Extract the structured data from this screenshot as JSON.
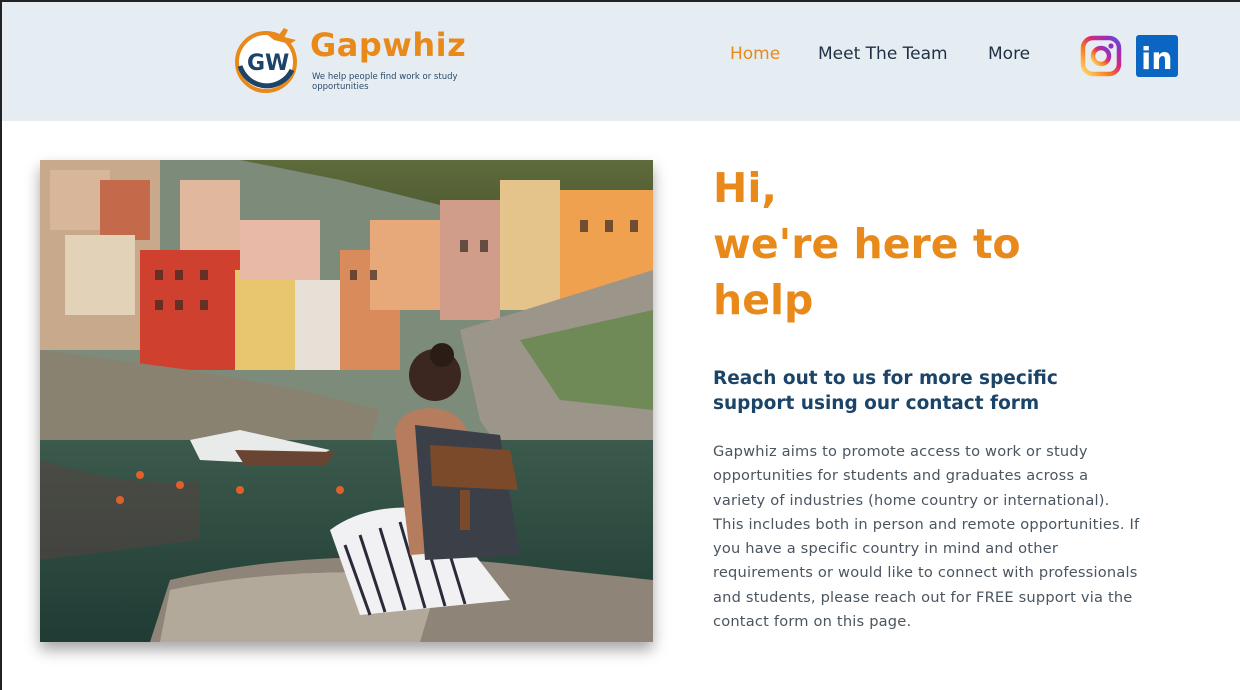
{
  "header": {
    "brand": "Gapwhiz",
    "logo_initials": "GW",
    "tagline": "We help people find work or study opportunities",
    "nav": [
      {
        "label": "Home",
        "active": true
      },
      {
        "label": "Meet The Team",
        "active": false
      },
      {
        "label": "More",
        "active": false
      }
    ],
    "social": [
      {
        "icon": "instagram-icon"
      },
      {
        "icon": "linkedin-icon",
        "glyph": "in"
      }
    ]
  },
  "hero": {
    "line1": "Hi,",
    "line2": "we're here to",
    "line3": "help"
  },
  "contact": {
    "heading": "Reach out to us for more specific support using our contact form",
    "body": "Gapwhiz aims to promote access to work or study opportunities for students and graduates across a variety of industries (home country or international). This includes both in person and remote opportunities. If you have a specific country in mind and other requirements or would like to connect with professionals and students, please reach out for FREE support via the contact form on this page."
  },
  "colors": {
    "accent": "#e8891a",
    "heading": "#1c4468",
    "header_bg": "#e6edf2",
    "linkedin": "#0a66c2"
  }
}
